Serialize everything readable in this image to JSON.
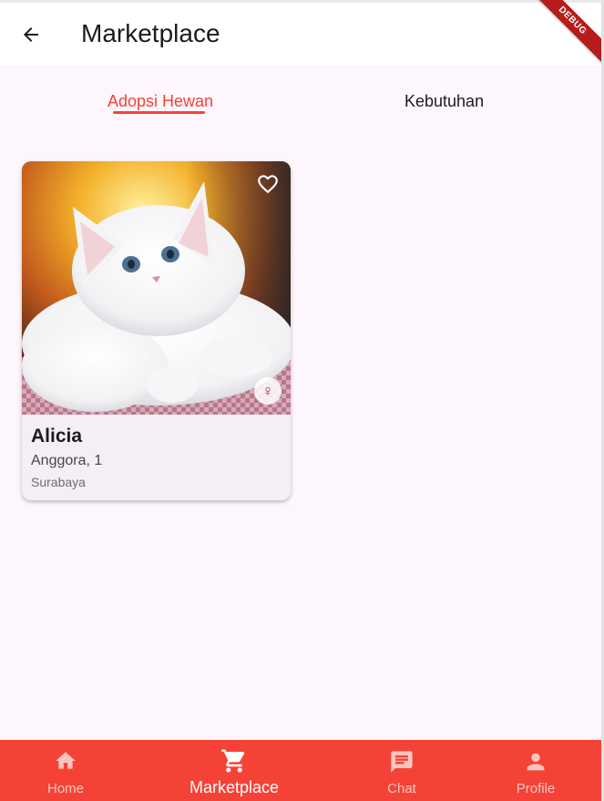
{
  "appbar": {
    "title": "Marketplace",
    "back_icon": "arrow-left-icon",
    "debug_label": "DEBUG"
  },
  "tabs": [
    {
      "label": "Adopsi Hewan",
      "active": true
    },
    {
      "label": "Kebutuhan",
      "active": false
    }
  ],
  "listings": [
    {
      "name": "Alicia",
      "breed_age": "Anggora, 1",
      "city": "Surabaya",
      "gender_icon": "female-icon",
      "gender_glyph": "♀",
      "favorite_icon": "heart-outline-icon"
    }
  ],
  "bottom_nav": [
    {
      "label": "Home",
      "icon": "home-icon",
      "active": false
    },
    {
      "label": "Marketplace",
      "icon": "shopping-cart-icon",
      "active": true
    },
    {
      "label": "Chat",
      "icon": "chat-icon",
      "active": false
    },
    {
      "label": "Profile",
      "icon": "person-icon",
      "active": false
    }
  ],
  "colors": {
    "accent": "#f44336",
    "background": "#fdf6fc",
    "card": "#f4eff4",
    "nav_inactive": "#fbc4bf"
  }
}
